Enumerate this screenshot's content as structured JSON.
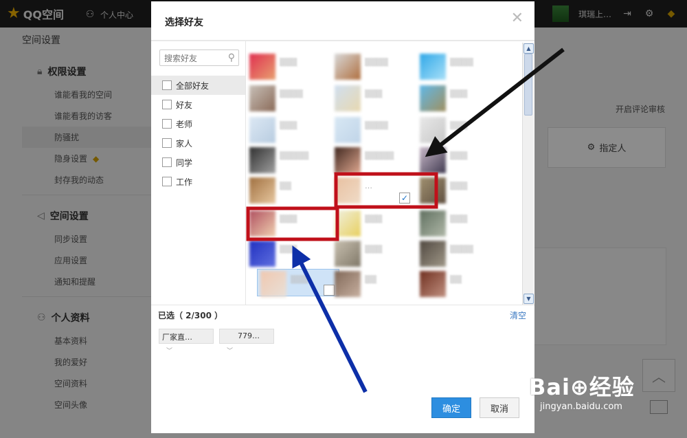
{
  "topbar": {
    "logo": "QQ空间",
    "nav_personal": "个人中心",
    "username": "琪瑞上…"
  },
  "page": {
    "title": "空间设置",
    "sections": [
      {
        "title": "权限设置",
        "icon": "lock-icon",
        "items": [
          "谁能看我的空间",
          "谁能看我的访客",
          "防骚扰",
          "隐身设置",
          "封存我的动态"
        ]
      },
      {
        "title": "空间设置",
        "icon": "speaker-icon",
        "items": [
          "同步设置",
          "应用设置",
          "通知和提醒"
        ]
      },
      {
        "title": "个人资料",
        "icon": "person-icon",
        "items": [
          "基本资料",
          "我的爱好",
          "空间资料",
          "空间头像"
        ]
      }
    ],
    "active_item": "防骚扰",
    "right_link": "开启评论审核",
    "right_button": "指定人"
  },
  "dialog": {
    "title": "选择好友",
    "search_placeholder": "搜索好友",
    "groups": [
      "全部好友",
      "好友",
      "老师",
      "家人",
      "同学",
      "工作"
    ],
    "selected_group": "全部好友",
    "selected_count": "已选（ 2/300 ）",
    "clear_label": "清空",
    "selected_chips": [
      "厂家直…",
      "779…"
    ],
    "checked_friend_name": "…",
    "ok_label": "确定",
    "cancel_label": "取消"
  },
  "annotation_colors": {
    "highlight_box": "#c0101a",
    "arrow_black": "#111111",
    "arrow_blue": "#0d2fa8"
  },
  "watermark": {
    "logo": "Bai⊕经验",
    "url": "jingyan.baidu.com"
  }
}
